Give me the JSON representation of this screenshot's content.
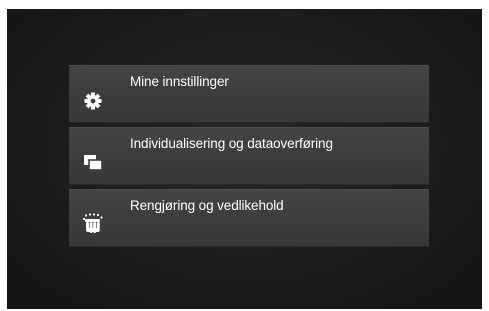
{
  "menu": {
    "items": [
      {
        "label": "Mine innstillinger",
        "icon": "gear-icon"
      },
      {
        "label": "Individualisering og dataoverføring",
        "icon": "data-transfer-icon"
      },
      {
        "label": "Rengjøring og vedlikehold",
        "icon": "cleaning-hand-icon"
      }
    ]
  },
  "colors": {
    "background": "#1c1c1c",
    "item_background": "#3d3d3d",
    "text": "#ffffff"
  }
}
